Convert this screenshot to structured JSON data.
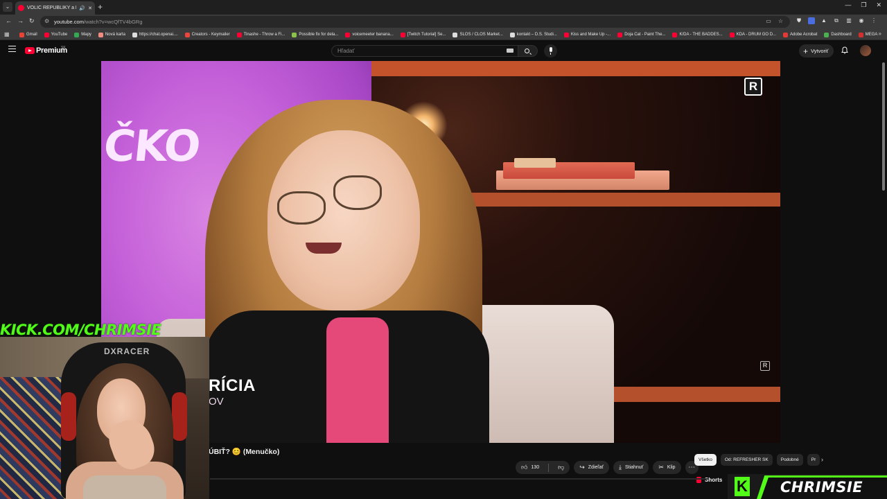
{
  "browser": {
    "tab_title": "VOLIČ REPUBLIKY a PS-ka...",
    "url_host": "youtube.com",
    "url_path": "/watch?v=wcQfTV4bGRg",
    "bookmarks": [
      {
        "label": "Gmail",
        "color": "#ea4335"
      },
      {
        "label": "YouTube",
        "color": "#ff0033"
      },
      {
        "label": "Mapy",
        "color": "#34a853"
      },
      {
        "label": "Nová karta",
        "color": "#f28b82"
      },
      {
        "label": "https://chat.openai....",
        "color": "#dddddd"
      },
      {
        "label": "Creators - Keymailer",
        "color": "#e8453c"
      },
      {
        "label": "Tinashe - Throw a Fi...",
        "color": "#ff0033"
      },
      {
        "label": "Possible fix for dela...",
        "color": "#8bc34a"
      },
      {
        "label": "voicemeeter banana...",
        "color": "#ff0033"
      },
      {
        "label": "[Twitch Tutorial] Se...",
        "color": "#ff0033"
      },
      {
        "label": "SLOS / CLOS Market...",
        "color": "#dddddd"
      },
      {
        "label": "kontakt – D.S. Studi...",
        "color": "#dddddd"
      },
      {
        "label": "Kiss and Make Up -...",
        "color": "#ff0033"
      },
      {
        "label": "Doja Cat - Paint The...",
        "color": "#ff0033"
      },
      {
        "label": "K/DA - THE BADDES...",
        "color": "#ff0033"
      },
      {
        "label": "KDA - DRUM GO D...",
        "color": "#ff0033"
      },
      {
        "label": "Adobe Acrobat",
        "color": "#e53935"
      },
      {
        "label": "Dashboard",
        "color": "#4caf50"
      },
      {
        "label": "MEGA",
        "color": "#d32f2f"
      }
    ]
  },
  "masthead": {
    "logo_text": "Premium",
    "region": "SK",
    "search_placeholder": "Hľadať",
    "create_label": "Vytvoriť"
  },
  "player": {
    "scene_text": "ČKO",
    "lower_third_name": "RÍCIA",
    "lower_third_sub": "OV",
    "channel_badge": "R"
  },
  "video": {
    "title": "ÚBIŤ? 😊 (Menučko)",
    "likes": "130",
    "share_label": "Zdieľať",
    "download_label": "Stiahnuť",
    "clip_label": "Klip"
  },
  "chips": [
    "Všetko",
    "Od: REFRESHER SK",
    "Podobné",
    "Pr"
  ],
  "shorts_label": "Shorts",
  "overlay": {
    "kick_url": "KICK.COM/CHRIMSIE",
    "webcam_brand": "DXRACER",
    "badge_name": "CHRIMSIE"
  },
  "colors": {
    "kick_green": "#53fc18",
    "youtube_red": "#ff0033",
    "background": "#0f0f0f"
  }
}
